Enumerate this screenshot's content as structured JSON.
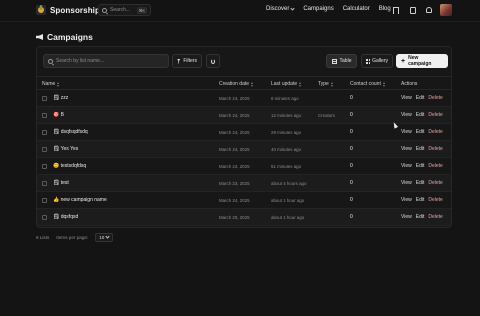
{
  "header": {
    "brand": "Sponsorship",
    "search_placeholder": "Search...",
    "search_shortcut": "⌘K",
    "nav": [
      {
        "label": "Discover",
        "dropdown": true
      },
      {
        "label": "Campaigns"
      },
      {
        "label": "Calculator"
      },
      {
        "label": "Blog"
      }
    ],
    "icons": [
      "bookmark-icon",
      "document-icon",
      "bell-icon",
      "avatar"
    ]
  },
  "page": {
    "title": "Campaigns",
    "title_icon": "megaphone-icon"
  },
  "toolbar": {
    "search_placeholder": "Search by list name...",
    "filters_label": "Filters",
    "table_label": "Table",
    "gallery_label": "Gallery",
    "new_campaign_label": "New campaign"
  },
  "table": {
    "columns": [
      "Name",
      "Creation date",
      "Last update",
      "Type",
      "Contact count",
      "Actions"
    ],
    "actions": {
      "view": "View",
      "edit": "Edit",
      "delete": "Delete"
    },
    "rows": [
      {
        "name": "🗒 zzz",
        "created": "March 24, 2025",
        "updated": "8 minutes ago",
        "type": "",
        "count": "0"
      },
      {
        "name": "🎯 B",
        "created": "March 24, 2025",
        "updated": "12 minutes ago",
        "type": "Creators",
        "count": "0"
      },
      {
        "name": "🗒 dsqfsqdfsdq",
        "created": "March 24, 2025",
        "updated": "29 minutes ago",
        "type": "",
        "count": "0"
      },
      {
        "name": "🗒 Yes Yes",
        "created": "March 24, 2025",
        "updated": "40 minutes ago",
        "type": "",
        "count": "0"
      },
      {
        "name": "😊 testsdqfdsq",
        "created": "March 24, 2025",
        "updated": "51 minutes ago",
        "type": "",
        "count": "0"
      },
      {
        "name": "🗒 test",
        "created": "March 23, 2025",
        "updated": "about 4 hours ago",
        "type": "",
        "count": "0"
      },
      {
        "name": "👍 new campaign name",
        "created": "March 24, 2025",
        "updated": "about 1 hour ago",
        "type": "",
        "count": "0"
      },
      {
        "name": "🗒 dqsfqsd",
        "created": "March 20, 2025",
        "updated": "about 1 hour ago",
        "type": "",
        "count": "0"
      }
    ]
  },
  "footer": {
    "count_text": "8 Lists",
    "per_page_label": "Items per page:",
    "per_page_value": "10"
  }
}
